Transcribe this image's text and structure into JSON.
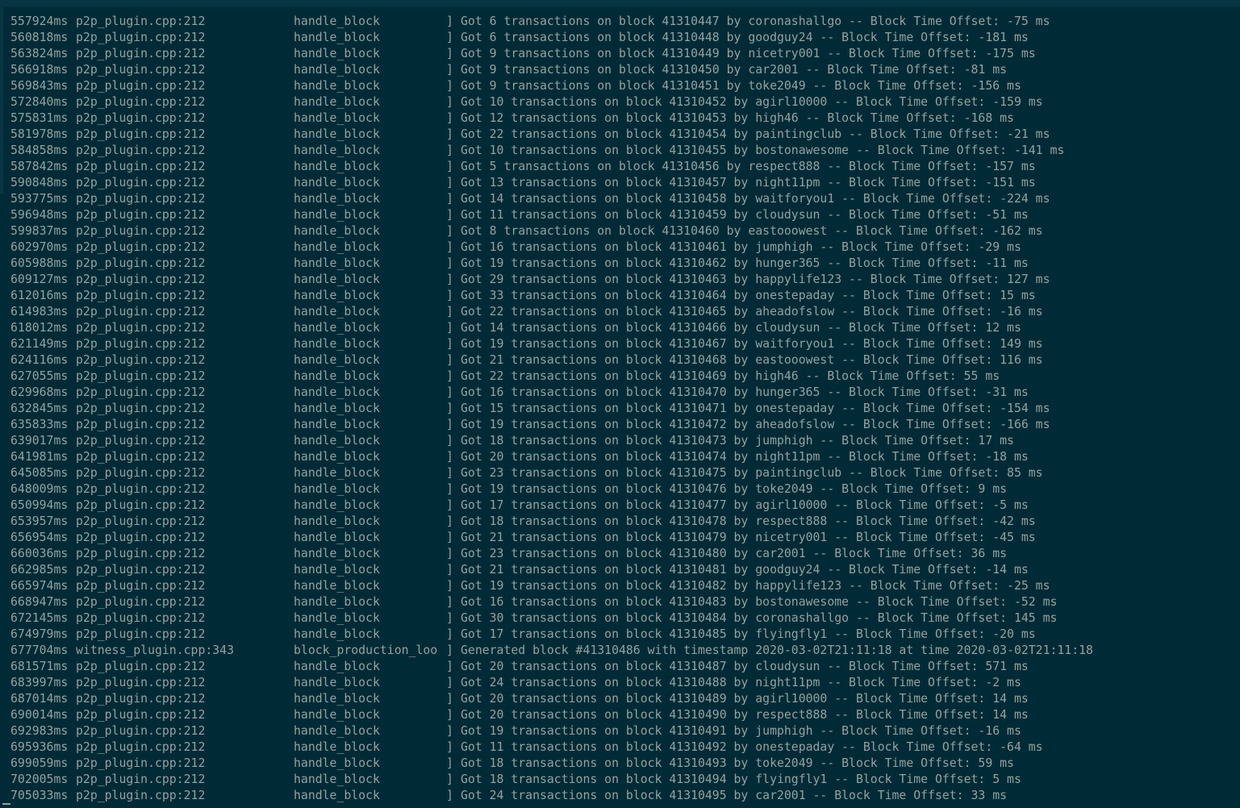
{
  "log_lines": [
    {
      "ts": "557924ms",
      "src": "p2p_plugin.cpp:212",
      "fn": "handle_block",
      "bracket": "]",
      "msg": "Got 6 transactions on block 41310447 by coronashallgo -- Block Time Offset: -75 ms"
    },
    {
      "ts": "560818ms",
      "src": "p2p_plugin.cpp:212",
      "fn": "handle_block",
      "bracket": "]",
      "msg": "Got 6 transactions on block 41310448 by goodguy24 -- Block Time Offset: -181 ms"
    },
    {
      "ts": "563824ms",
      "src": "p2p_plugin.cpp:212",
      "fn": "handle_block",
      "bracket": "]",
      "msg": "Got 9 transactions on block 41310449 by nicetry001 -- Block Time Offset: -175 ms"
    },
    {
      "ts": "566918ms",
      "src": "p2p_plugin.cpp:212",
      "fn": "handle_block",
      "bracket": "]",
      "msg": "Got 9 transactions on block 41310450 by car2001 -- Block Time Offset: -81 ms"
    },
    {
      "ts": "569843ms",
      "src": "p2p_plugin.cpp:212",
      "fn": "handle_block",
      "bracket": "]",
      "msg": "Got 9 transactions on block 41310451 by toke2049 -- Block Time Offset: -156 ms"
    },
    {
      "ts": "572840ms",
      "src": "p2p_plugin.cpp:212",
      "fn": "handle_block",
      "bracket": "]",
      "msg": "Got 10 transactions on block 41310452 by agirl10000 -- Block Time Offset: -159 ms"
    },
    {
      "ts": "575831ms",
      "src": "p2p_plugin.cpp:212",
      "fn": "handle_block",
      "bracket": "]",
      "msg": "Got 12 transactions on block 41310453 by high46 -- Block Time Offset: -168 ms"
    },
    {
      "ts": "581978ms",
      "src": "p2p_plugin.cpp:212",
      "fn": "handle_block",
      "bracket": "]",
      "msg": "Got 22 transactions on block 41310454 by paintingclub -- Block Time Offset: -21 ms"
    },
    {
      "ts": "584858ms",
      "src": "p2p_plugin.cpp:212",
      "fn": "handle_block",
      "bracket": "]",
      "msg": "Got 10 transactions on block 41310455 by bostonawesome -- Block Time Offset: -141 ms"
    },
    {
      "ts": "587842ms",
      "src": "p2p_plugin.cpp:212",
      "fn": "handle_block",
      "bracket": "]",
      "msg": "Got 5 transactions on block 41310456 by respect888 -- Block Time Offset: -157 ms"
    },
    {
      "ts": "590848ms",
      "src": "p2p_plugin.cpp:212",
      "fn": "handle_block",
      "bracket": "]",
      "msg": "Got 13 transactions on block 41310457 by night11pm -- Block Time Offset: -151 ms"
    },
    {
      "ts": "593775ms",
      "src": "p2p_plugin.cpp:212",
      "fn": "handle_block",
      "bracket": "]",
      "msg": "Got 14 transactions on block 41310458 by waitforyou1 -- Block Time Offset: -224 ms"
    },
    {
      "ts": "596948ms",
      "src": "p2p_plugin.cpp:212",
      "fn": "handle_block",
      "bracket": "]",
      "msg": "Got 11 transactions on block 41310459 by cloudysun -- Block Time Offset: -51 ms"
    },
    {
      "ts": "599837ms",
      "src": "p2p_plugin.cpp:212",
      "fn": "handle_block",
      "bracket": "]",
      "msg": "Got 8 transactions on block 41310460 by eastooowest -- Block Time Offset: -162 ms"
    },
    {
      "ts": "602970ms",
      "src": "p2p_plugin.cpp:212",
      "fn": "handle_block",
      "bracket": "]",
      "msg": "Got 16 transactions on block 41310461 by jumphigh -- Block Time Offset: -29 ms"
    },
    {
      "ts": "605988ms",
      "src": "p2p_plugin.cpp:212",
      "fn": "handle_block",
      "bracket": "]",
      "msg": "Got 19 transactions on block 41310462 by hunger365 -- Block Time Offset: -11 ms"
    },
    {
      "ts": "609127ms",
      "src": "p2p_plugin.cpp:212",
      "fn": "handle_block",
      "bracket": "]",
      "msg": "Got 29 transactions on block 41310463 by happylife123 -- Block Time Offset: 127 ms"
    },
    {
      "ts": "612016ms",
      "src": "p2p_plugin.cpp:212",
      "fn": "handle_block",
      "bracket": "]",
      "msg": "Got 33 transactions on block 41310464 by onestepaday -- Block Time Offset: 15 ms"
    },
    {
      "ts": "614983ms",
      "src": "p2p_plugin.cpp:212",
      "fn": "handle_block",
      "bracket": "]",
      "msg": "Got 22 transactions on block 41310465 by aheadofslow -- Block Time Offset: -16 ms"
    },
    {
      "ts": "618012ms",
      "src": "p2p_plugin.cpp:212",
      "fn": "handle_block",
      "bracket": "]",
      "msg": "Got 14 transactions on block 41310466 by cloudysun -- Block Time Offset: 12 ms"
    },
    {
      "ts": "621149ms",
      "src": "p2p_plugin.cpp:212",
      "fn": "handle_block",
      "bracket": "]",
      "msg": "Got 19 transactions on block 41310467 by waitforyou1 -- Block Time Offset: 149 ms"
    },
    {
      "ts": "624116ms",
      "src": "p2p_plugin.cpp:212",
      "fn": "handle_block",
      "bracket": "]",
      "msg": "Got 21 transactions on block 41310468 by eastooowest -- Block Time Offset: 116 ms"
    },
    {
      "ts": "627055ms",
      "src": "p2p_plugin.cpp:212",
      "fn": "handle_block",
      "bracket": "]",
      "msg": "Got 22 transactions on block 41310469 by high46 -- Block Time Offset: 55 ms"
    },
    {
      "ts": "629968ms",
      "src": "p2p_plugin.cpp:212",
      "fn": "handle_block",
      "bracket": "]",
      "msg": "Got 16 transactions on block 41310470 by hunger365 -- Block Time Offset: -31 ms"
    },
    {
      "ts": "632845ms",
      "src": "p2p_plugin.cpp:212",
      "fn": "handle_block",
      "bracket": "]",
      "msg": "Got 15 transactions on block 41310471 by onestepaday -- Block Time Offset: -154 ms"
    },
    {
      "ts": "635833ms",
      "src": "p2p_plugin.cpp:212",
      "fn": "handle_block",
      "bracket": "]",
      "msg": "Got 19 transactions on block 41310472 by aheadofslow -- Block Time Offset: -166 ms"
    },
    {
      "ts": "639017ms",
      "src": "p2p_plugin.cpp:212",
      "fn": "handle_block",
      "bracket": "]",
      "msg": "Got 18 transactions on block 41310473 by jumphigh -- Block Time Offset: 17 ms"
    },
    {
      "ts": "641981ms",
      "src": "p2p_plugin.cpp:212",
      "fn": "handle_block",
      "bracket": "]",
      "msg": "Got 20 transactions on block 41310474 by night11pm -- Block Time Offset: -18 ms"
    },
    {
      "ts": "645085ms",
      "src": "p2p_plugin.cpp:212",
      "fn": "handle_block",
      "bracket": "]",
      "msg": "Got 23 transactions on block 41310475 by paintingclub -- Block Time Offset: 85 ms"
    },
    {
      "ts": "648009ms",
      "src": "p2p_plugin.cpp:212",
      "fn": "handle_block",
      "bracket": "]",
      "msg": "Got 19 transactions on block 41310476 by toke2049 -- Block Time Offset: 9 ms"
    },
    {
      "ts": "650994ms",
      "src": "p2p_plugin.cpp:212",
      "fn": "handle_block",
      "bracket": "]",
      "msg": "Got 17 transactions on block 41310477 by agirl10000 -- Block Time Offset: -5 ms"
    },
    {
      "ts": "653957ms",
      "src": "p2p_plugin.cpp:212",
      "fn": "handle_block",
      "bracket": "]",
      "msg": "Got 18 transactions on block 41310478 by respect888 -- Block Time Offset: -42 ms"
    },
    {
      "ts": "656954ms",
      "src": "p2p_plugin.cpp:212",
      "fn": "handle_block",
      "bracket": "]",
      "msg": "Got 21 transactions on block 41310479 by nicetry001 -- Block Time Offset: -45 ms"
    },
    {
      "ts": "660036ms",
      "src": "p2p_plugin.cpp:212",
      "fn": "handle_block",
      "bracket": "]",
      "msg": "Got 23 transactions on block 41310480 by car2001 -- Block Time Offset: 36 ms"
    },
    {
      "ts": "662985ms",
      "src": "p2p_plugin.cpp:212",
      "fn": "handle_block",
      "bracket": "]",
      "msg": "Got 21 transactions on block 41310481 by goodguy24 -- Block Time Offset: -14 ms"
    },
    {
      "ts": "665974ms",
      "src": "p2p_plugin.cpp:212",
      "fn": "handle_block",
      "bracket": "]",
      "msg": "Got 19 transactions on block 41310482 by happylife123 -- Block Time Offset: -25 ms"
    },
    {
      "ts": "668947ms",
      "src": "p2p_plugin.cpp:212",
      "fn": "handle_block",
      "bracket": "]",
      "msg": "Got 16 transactions on block 41310483 by bostonawesome -- Block Time Offset: -52 ms"
    },
    {
      "ts": "672145ms",
      "src": "p2p_plugin.cpp:212",
      "fn": "handle_block",
      "bracket": "]",
      "msg": "Got 30 transactions on block 41310484 by coronashallgo -- Block Time Offset: 145 ms"
    },
    {
      "ts": "674979ms",
      "src": "p2p_plugin.cpp:212",
      "fn": "handle_block",
      "bracket": "]",
      "msg": "Got 17 transactions on block 41310485 by flyingfly1 -- Block Time Offset: -20 ms"
    },
    {
      "ts": "677704ms",
      "src": "witness_plugin.cpp:343",
      "fn": "block_production_loo",
      "bracket": "]",
      "msg": "Generated block #41310486 with timestamp 2020-03-02T21:11:18 at time 2020-03-02T21:11:18"
    },
    {
      "ts": "681571ms",
      "src": "p2p_plugin.cpp:212",
      "fn": "handle_block",
      "bracket": "]",
      "msg": "Got 20 transactions on block 41310487 by cloudysun -- Block Time Offset: 571 ms"
    },
    {
      "ts": "683997ms",
      "src": "p2p_plugin.cpp:212",
      "fn": "handle_block",
      "bracket": "]",
      "msg": "Got 24 transactions on block 41310488 by night11pm -- Block Time Offset: -2 ms"
    },
    {
      "ts": "687014ms",
      "src": "p2p_plugin.cpp:212",
      "fn": "handle_block",
      "bracket": "]",
      "msg": "Got 20 transactions on block 41310489 by agirl10000 -- Block Time Offset: 14 ms"
    },
    {
      "ts": "690014ms",
      "src": "p2p_plugin.cpp:212",
      "fn": "handle_block",
      "bracket": "]",
      "msg": "Got 20 transactions on block 41310490 by respect888 -- Block Time Offset: 14 ms"
    },
    {
      "ts": "692983ms",
      "src": "p2p_plugin.cpp:212",
      "fn": "handle_block",
      "bracket": "]",
      "msg": "Got 19 transactions on block 41310491 by jumphigh -- Block Time Offset: -16 ms"
    },
    {
      "ts": "695936ms",
      "src": "p2p_plugin.cpp:212",
      "fn": "handle_block",
      "bracket": "]",
      "msg": "Got 11 transactions on block 41310492 by onestepaday -- Block Time Offset: -64 ms"
    },
    {
      "ts": "699059ms",
      "src": "p2p_plugin.cpp:212",
      "fn": "handle_block",
      "bracket": "]",
      "msg": "Got 18 transactions on block 41310493 by toke2049 -- Block Time Offset: 59 ms"
    },
    {
      "ts": "702005ms",
      "src": "p2p_plugin.cpp:212",
      "fn": "handle_block",
      "bracket": "]",
      "msg": "Got 18 transactions on block 41310494 by flyingfly1 -- Block Time Offset: 5 ms"
    },
    {
      "ts": "705033ms",
      "src": "p2p_plugin.cpp:212",
      "fn": "handle_block",
      "bracket": "]",
      "msg": "Got 24 transactions on block 41310495 by car2001 -- Block Time Offset: 33 ms"
    }
  ],
  "colors": {
    "background": "#002b36",
    "text": "#93a1a1"
  }
}
